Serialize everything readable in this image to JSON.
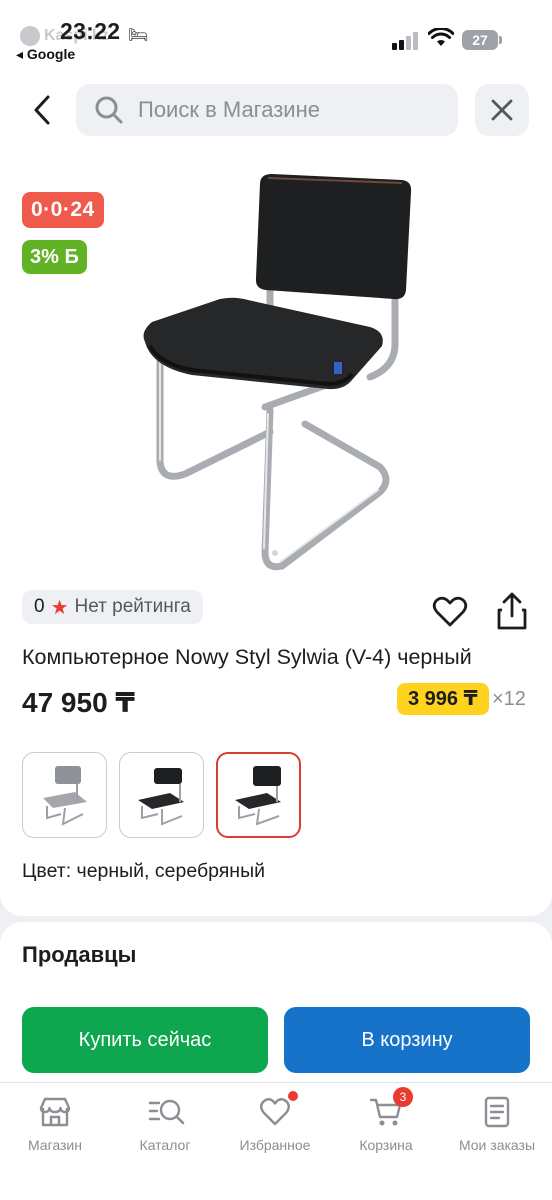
{
  "status_bar": {
    "time": "23:22",
    "back_app": "◂ Google",
    "app_ghost": "Kaspi.kz",
    "battery": "27"
  },
  "header": {
    "search_placeholder": "Поиск в Магазине"
  },
  "product": {
    "badge_price": "0·0·24",
    "badge_bonus": "3% Б",
    "rating_value": "0",
    "rating_text": "Нет рейтинга",
    "title": "Компьютерное Nowy Styl Sylwia (V-4) черный",
    "price": "47 950 ₸",
    "installment_price": "3 996 ₸",
    "installment_count": "×12",
    "color_label": "Цвет: черный, серебряный",
    "variants": [
      {
        "name": "grey",
        "selected": false
      },
      {
        "name": "black-thin",
        "selected": false
      },
      {
        "name": "black",
        "selected": true
      }
    ]
  },
  "sellers": {
    "title": "Продавцы",
    "buy_now": "Купить сейчас",
    "to_cart": "В корзину"
  },
  "bottom_nav": {
    "items": [
      {
        "label": "Магазин",
        "icon": "store-icon"
      },
      {
        "label": "Каталог",
        "icon": "catalog-search-icon"
      },
      {
        "label": "Избранное",
        "icon": "heart-icon"
      },
      {
        "label": "Корзина",
        "icon": "cart-icon",
        "badge": "3"
      },
      {
        "label": "Мои заказы",
        "icon": "orders-icon"
      }
    ]
  },
  "colors": {
    "price_badge": "#f05a4b",
    "bonus_badge": "#62b226",
    "installment": "#ffd21e",
    "buy_now": "#0fa650",
    "to_cart": "#1673c9"
  }
}
